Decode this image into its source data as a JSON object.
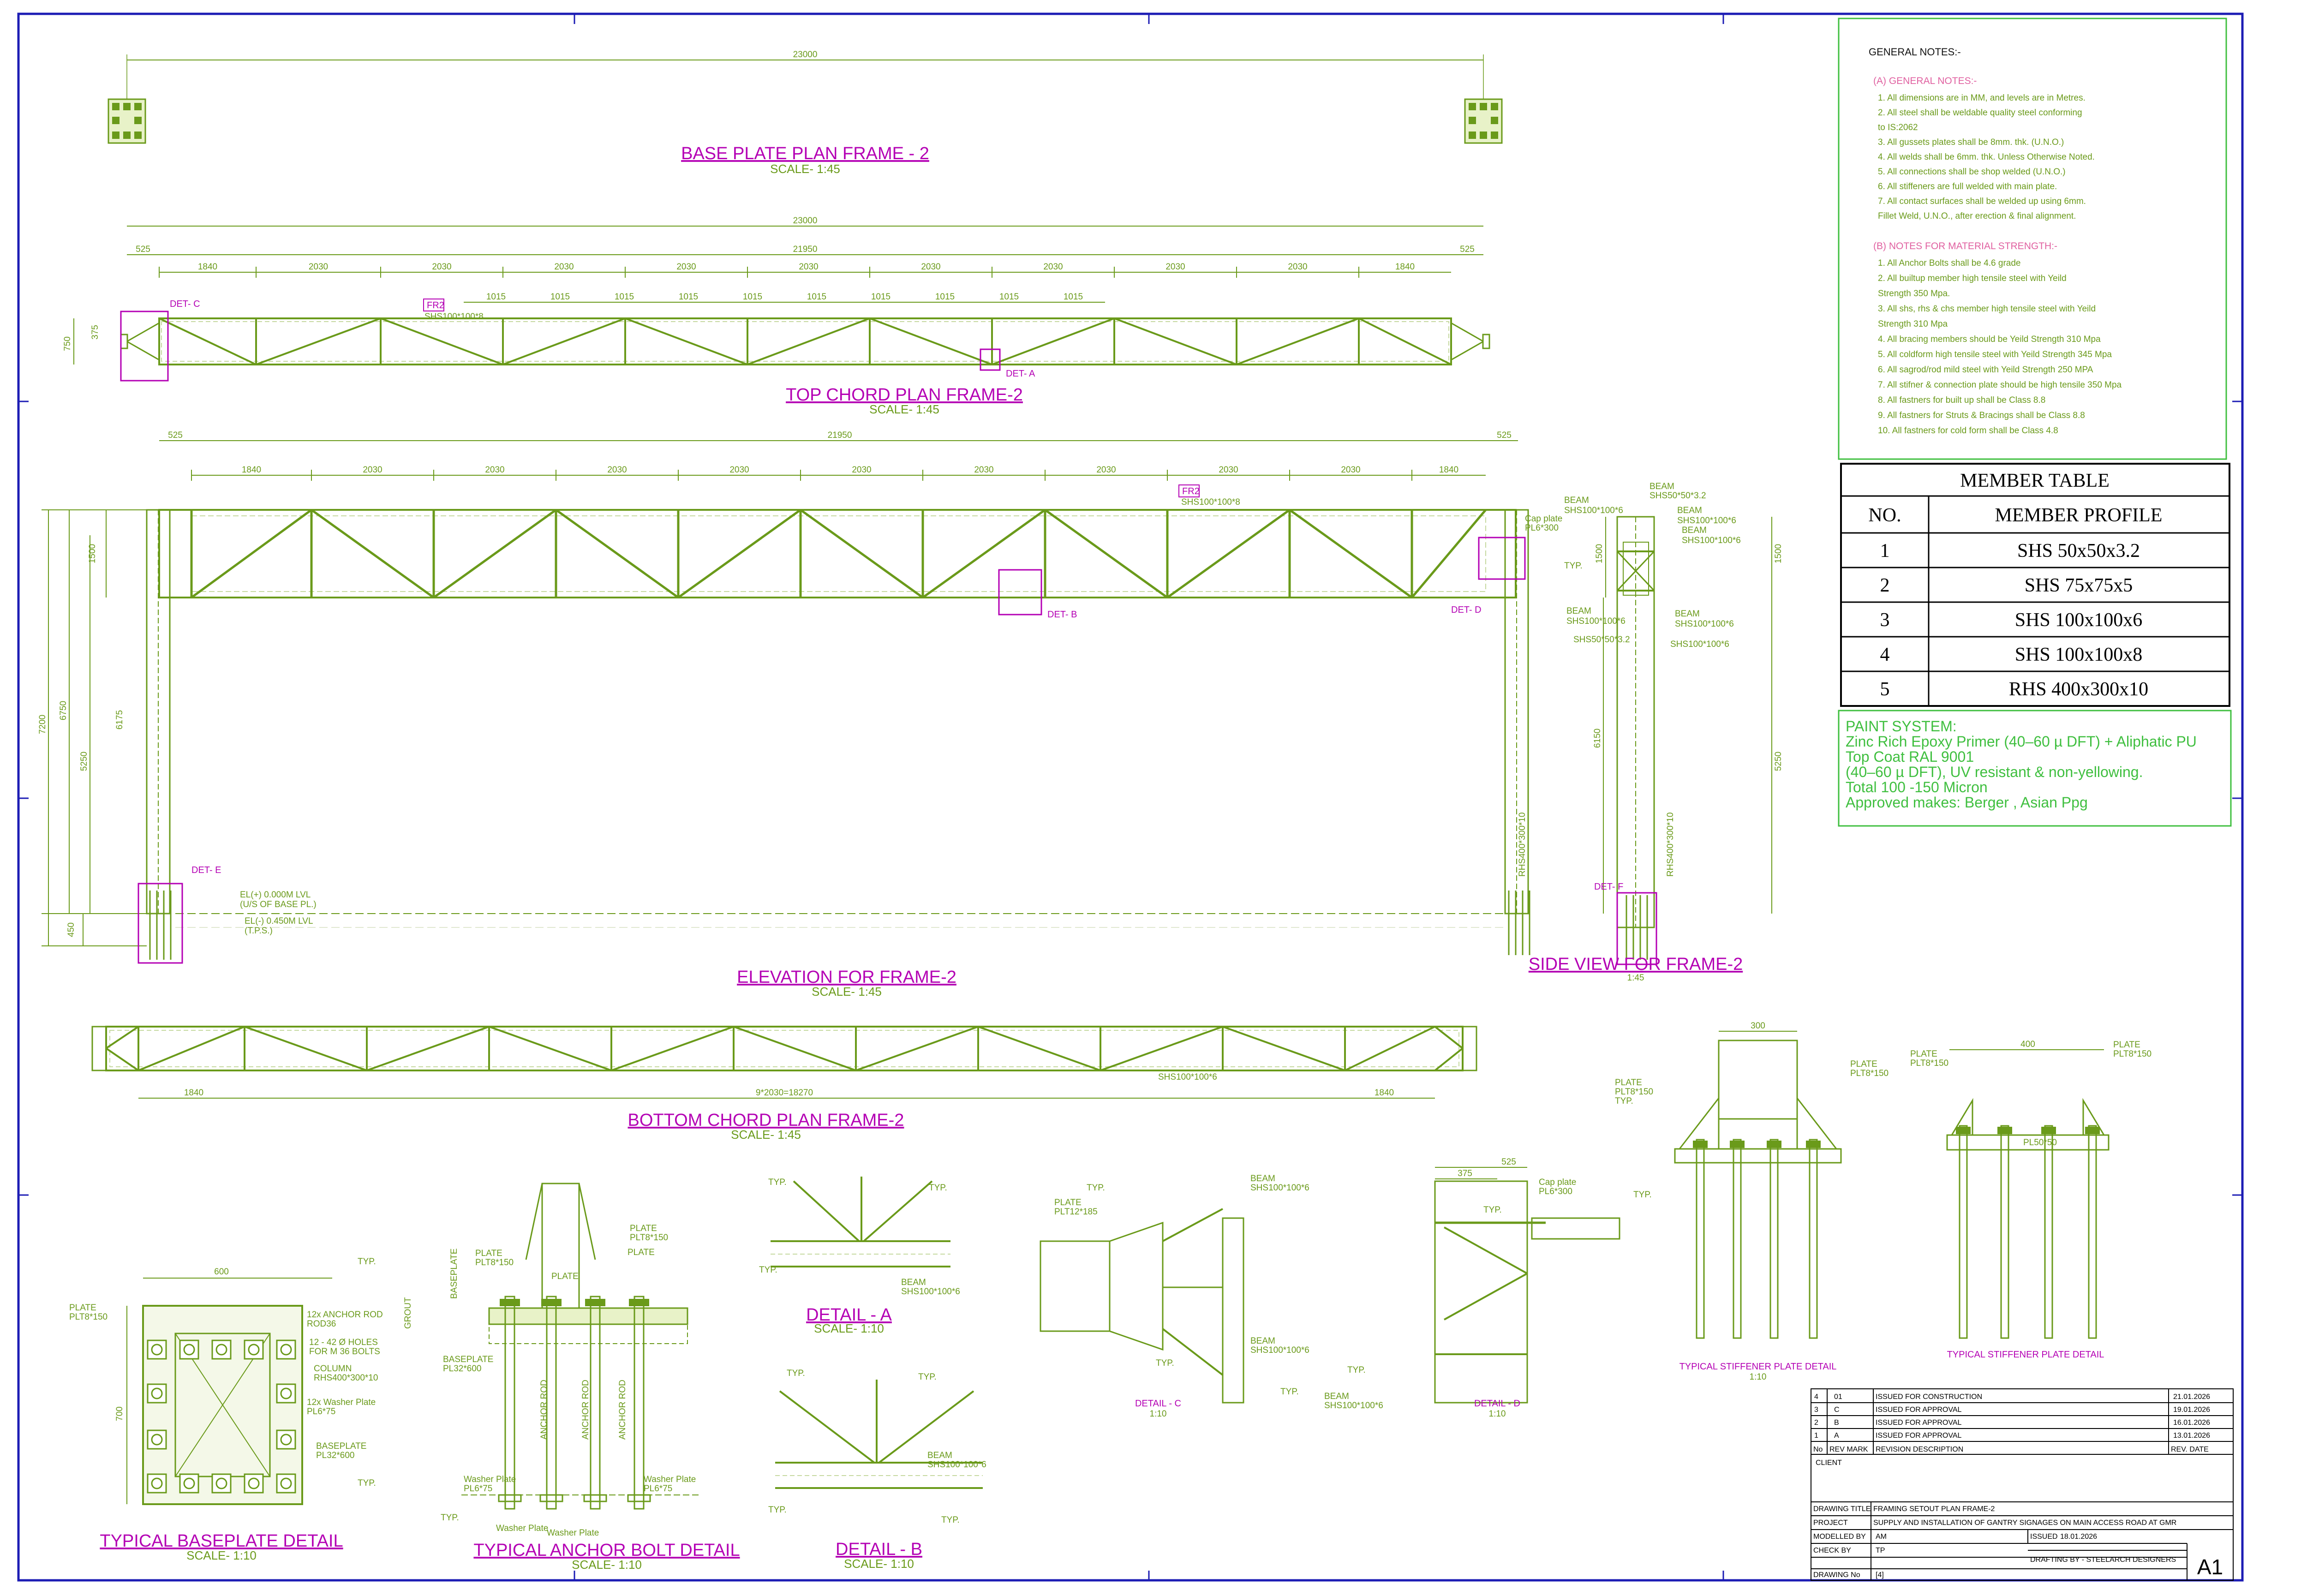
{
  "sheet": {
    "size_label": "A1"
  },
  "titles": {
    "base_plate_plan": "BASE PLATE PLAN FRAME - 2",
    "base_plate_plan_scale": "SCALE- 1:45",
    "top_chord_plan": "TOP CHORD PLAN FRAME-2",
    "top_chord_plan_scale": "SCALE- 1:45",
    "elevation": "ELEVATION FOR FRAME-2",
    "elevation_scale": "SCALE- 1:45",
    "side_view": "SIDE VIEW FOR FRAME-2",
    "side_view_scale": "1:45",
    "bottom_chord_plan": "BOTTOM CHORD PLAN FRAME-2",
    "bottom_chord_plan_scale": "SCALE- 1:45",
    "baseplate_detail": "TYPICAL BASEPLATE DETAIL",
    "baseplate_detail_scale": "SCALE- 1:10",
    "anchor_bolt_detail": "TYPICAL ANCHOR BOLT DETAIL",
    "anchor_bolt_detail_scale": "SCALE- 1:10",
    "detail_a": "DETAIL - A",
    "detail_a_scale": "SCALE- 1:10",
    "detail_b": "DETAIL - B",
    "detail_b_scale": "SCALE- 1:10",
    "detail_c": "DETAIL - C",
    "detail_c_scale": "1:10",
    "detail_d": "DETAIL - D",
    "detail_d_scale": "1:10",
    "stiffener_1": "TYPICAL STIFFENER PLATE DETAIL",
    "stiffener_1_scale": "1:10",
    "stiffener_2": "TYPICAL STIFFENER PLATE DETAIL"
  },
  "dimensions": {
    "overall": "23000",
    "span": "21950",
    "end": "525",
    "bay_end": "1840",
    "bay": "2030",
    "half_bay": "1015",
    "depth": "750",
    "half_depth": "375",
    "bottom_chord_total": "9*2030=18270",
    "elev_7200": "7200",
    "elev_6750": "6750",
    "elev_6175": "6175",
    "elev_5250": "5250",
    "elev_1500": "1500",
    "elev_450": "450",
    "side_6150": "6150"
  },
  "labels": {
    "det_a": "DET- A",
    "det_b": "DET- B",
    "det_c": "DET- C",
    "det_d": "DET- D",
    "det_e": "DET- E",
    "det_f": "DET- F",
    "fr2": "FR2",
    "shs100_8": "SHS100*100*8",
    "shs100_6": "SHS100*100*6",
    "shs50": "SHS50*50*3.2",
    "beam": "BEAM",
    "cap_plate": "Cap plate",
    "pl6_300": "PL6*300",
    "typ": "TYP.",
    "level_1": "EL(+) 0.000M LVL",
    "level_1b": "(U/S OF BASE PL.)",
    "level_2": "EL(-) 0.450M LVL",
    "level_2b": "(T.P.S.)",
    "column": "COLUMN",
    "rhs400": "RHS400*300*10",
    "plate": "PLATE",
    "plt8_150": "PLT8*150",
    "anchor_rod": "12x ANCHOR ROD",
    "rod36": "ROD36",
    "holes": "12 - 42 Ø HOLES",
    "holes_b": "FOR M 36 BOLTS",
    "washer": "12x Washer Plate",
    "pl6_75": "PL6*75",
    "baseplate": "BASEPLATE",
    "pl32_600": "PL32*600",
    "grout": "GROUT",
    "anchor_rod_v": "ANCHOR ROD",
    "washer_plate": "Washer Plate",
    "plt12_185": "PLT12*185",
    "pl50_50": "PL50*50"
  },
  "general_notes": {
    "heading": "GENERAL NOTES:-",
    "a_heading": "(A)  GENERAL  NOTES:-",
    "a_items": [
      "1.  All dimensions are in MM, and levels are in Metres.",
      "2.  All steel shall be weldable quality steel conforming",
      "     to IS:2062",
      "3.  All gussets plates shall be 8mm. thk. (U.N.O.)",
      "4.  All welds shall be 6mm. thk. Unless Otherwise Noted.",
      "5.  All connections shall be shop welded (U.N.O.)",
      "6.  All stiffeners are full welded with main plate.",
      "7.  All contact surfaces shall be welded up using 6mm.",
      "     Fillet Weld, U.N.O., after erection & final alignment."
    ],
    "b_heading": "(B)  NOTES  FOR  MATERIAL  STRENGTH:-",
    "b_items": [
      "1.  All Anchor Bolts shall be 4.6 grade",
      "2.  All builtup member high tensile steel with Yeild",
      "     Strength 350 Mpa.",
      "3.  All shs, rhs & chs member high tensile steel with Yeild",
      "     Strength 310 Mpa",
      "4.  All bracing members should be Yeild Strength 310 Mpa",
      "5.  All coldform high tensile steel with Yeild Strength 345 Mpa",
      "6.  All sagrod/rod mild steel with Yeild Strength 250 MPA",
      "7.  All stifner & connection plate should be high tensile 350 Mpa",
      "8.  All fastners for built up shall be Class 8.8",
      "9.  All fastners for Struts & Bracings shall be Class 8.8",
      "10. All fastners for cold form shall be Class 4.8"
    ]
  },
  "member_table": {
    "title": "MEMBER TABLE",
    "col_no": "NO.",
    "col_profile": "MEMBER PROFILE",
    "rows": [
      {
        "no": "1",
        "profile": "SHS 50x50x3.2"
      },
      {
        "no": "2",
        "profile": "SHS 75x75x5"
      },
      {
        "no": "3",
        "profile": "SHS 100x100x6"
      },
      {
        "no": "4",
        "profile": "SHS 100x100x8"
      },
      {
        "no": "5",
        "profile": "RHS 400x300x10"
      }
    ]
  },
  "paint_system": {
    "lines": [
      "PAINT SYSTEM:",
      "Zinc Rich Epoxy Primer (40–60 µ DFT) + Aliphatic PU",
      "Top Coat RAL 9001",
      "(40–60 µ DFT), UV resistant & non-yellowing.",
      "Total 100 -150 Micron",
      "Approved makes: Berger , Asian Ppg"
    ]
  },
  "revisions": {
    "rows": [
      {
        "no": "4",
        "mark": "01",
        "desc": "ISSUED FOR CONSTRUCTION",
        "date": "21.01.2026"
      },
      {
        "no": "3",
        "mark": "C",
        "desc": "ISSUED FOR APPROVAL",
        "date": "19.01.2026"
      },
      {
        "no": "2",
        "mark": "B",
        "desc": "ISSUED FOR APPROVAL",
        "date": "16.01.2026"
      },
      {
        "no": "1",
        "mark": "A",
        "desc": "ISSUED FOR APPROVAL",
        "date": "13.01.2026"
      }
    ],
    "header": {
      "no": "No",
      "mark": "REV MARK",
      "desc": "REVISION DESCRIPTION",
      "date": "REV. DATE"
    }
  },
  "title_block": {
    "client_label": "CLIENT",
    "drawing_title_label": "DRAWING TITLE",
    "drawing_title": "FRAMING SETOUT PLAN FRAME-2",
    "project_label": "PROJECT",
    "project": "SUPPLY AND INSTALLATION OF  GANTRY SIGNAGES ON MAIN ACCESS ROAD AT GMR",
    "modelled_label": "MODELLED BY",
    "modelled": "AM",
    "issued_label": "ISSUED",
    "issued": "18.01.2026",
    "check_label": "CHECK BY",
    "check": "TP",
    "drafting": "DRAFTING BY - STEELARCH DESIGNERS",
    "drawing_no_label": "DRAWING No",
    "drawing_no": "[4]"
  },
  "colors": {
    "steel": "#6a9a1a",
    "title": "#b400b4",
    "border": "#1c1cb4",
    "notes_box": "#3fbf3f"
  }
}
